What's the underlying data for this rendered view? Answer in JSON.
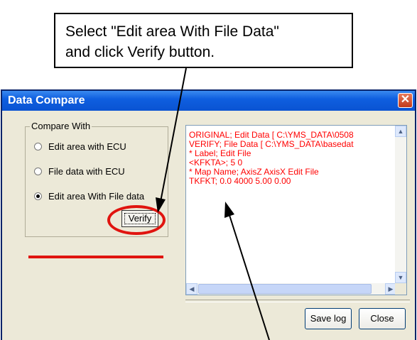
{
  "callout": {
    "line1": "Select \"Edit area With File Data\"",
    "line2": "and click Verify button."
  },
  "dialog": {
    "title": "Data Compare",
    "close_glyph": "✕",
    "group_label": "Compare With",
    "options": [
      {
        "label": "Edit area with ECU",
        "selected": false
      },
      {
        "label": "File data with ECU",
        "selected": false
      },
      {
        "label": "Edit area With File data",
        "selected": true
      }
    ],
    "verify_label": "Verify",
    "log_lines": [
      "ORIGINAL; Edit Data [ C:\\YMS_DATA\\0508",
      "VERIFY; File Data [ C:\\YMS_DATA\\basedat",
      "* Label; Edit File",
      "<KFKTA>; 5 0",
      "* Map Name; AxisZ AxisX Edit File",
      "TKFKT; 0.0 4000 5.00 0.00"
    ],
    "save_log_label": "Save log",
    "close_label": "Close"
  },
  "colors": {
    "annotation": "#e0140f",
    "log_text": "#ff0000",
    "titlebar": "#0a53d2"
  },
  "icons": {
    "scroll_up": "up-arrow-icon",
    "scroll_down": "down-arrow-icon",
    "scroll_left": "left-arrow-icon",
    "scroll_right": "right-arrow-icon"
  }
}
